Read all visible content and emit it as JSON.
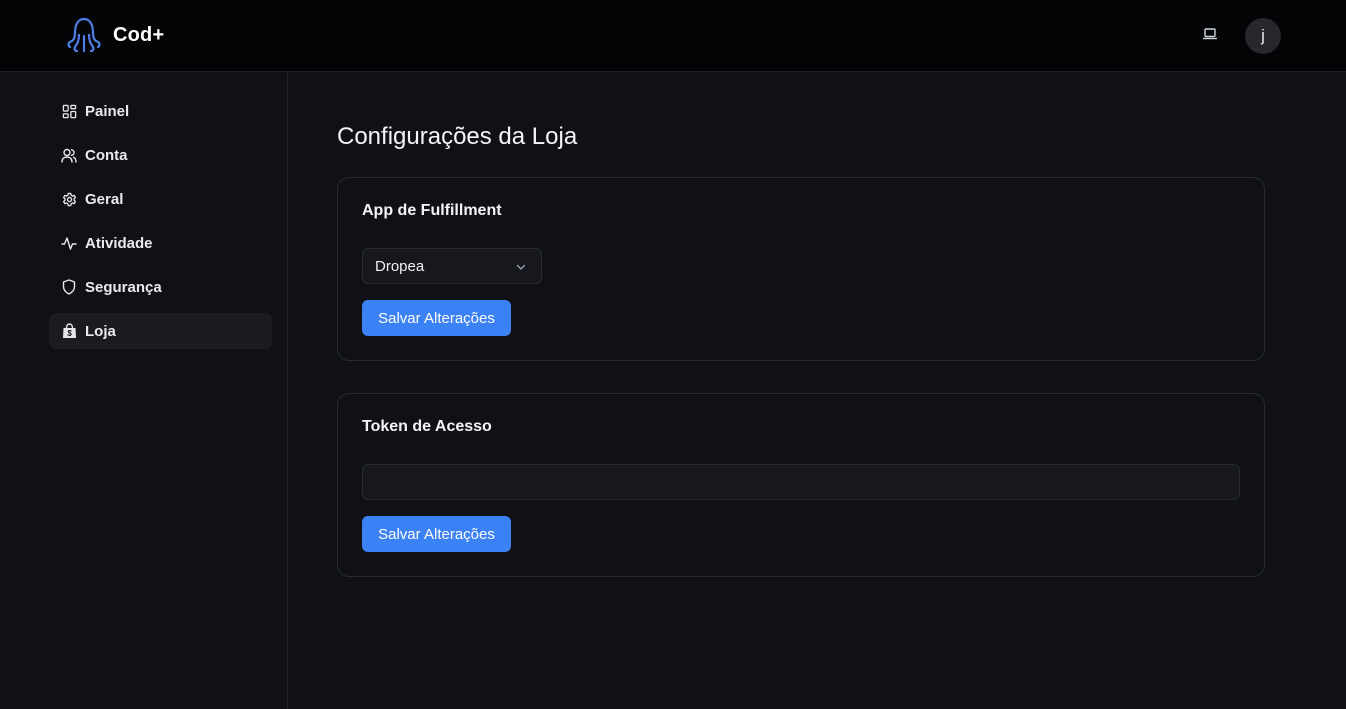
{
  "header": {
    "app_name": "Cod+",
    "logo_icon": "octopus-logo-icon",
    "theme_icon": "laptop-icon",
    "avatar_initial": "j"
  },
  "sidebar": {
    "items": [
      {
        "label": "Painel",
        "icon": "dashboard-grid-icon",
        "active": false
      },
      {
        "label": "Conta",
        "icon": "users-icon",
        "active": false
      },
      {
        "label": "Geral",
        "icon": "gear-icon",
        "active": false
      },
      {
        "label": "Atividade",
        "icon": "activity-icon",
        "active": false
      },
      {
        "label": "Segurança",
        "icon": "shield-icon",
        "active": false
      },
      {
        "label": "Loja",
        "icon": "shopping-bag-icon",
        "active": true
      }
    ]
  },
  "main": {
    "title": "Configurações da Loja",
    "fulfillment": {
      "title": "App de Fulfillment",
      "selected": "Dropea",
      "save_label": "Salvar Alterações"
    },
    "token": {
      "title": "Token de Acesso",
      "value": "",
      "save_label": "Salvar Alterações"
    }
  },
  "colors": {
    "accent": "#3b82f6",
    "background": "#0f1117",
    "header_background": "#030406",
    "logo": "#4f7fe6"
  }
}
